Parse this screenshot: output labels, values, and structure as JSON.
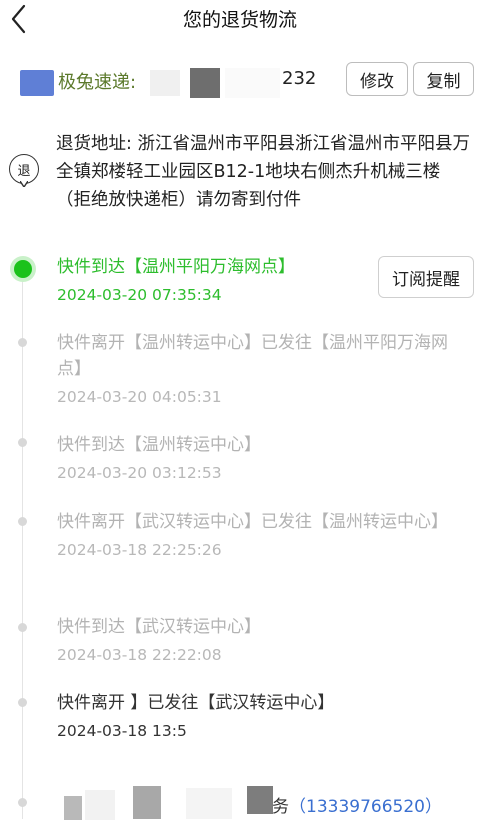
{
  "header": {
    "title": "您的退货物流"
  },
  "courier": {
    "name": "极兔速递:",
    "tracking_tail": "232",
    "edit_label": "修改",
    "copy_label": "复制",
    "logo_color": "#5f7fd6"
  },
  "address": {
    "icon_label": "退",
    "text": "退货地址: 浙江省温州市平阳县浙江省温州市平阳县万全镇郑楼轻工业园区B12-1地块右侧杰升机械三楼（拒绝放快递柜）请勿寄到付件"
  },
  "timeline": {
    "subscribe_label": "订阅提醒",
    "active_color": "#2dbd2d",
    "events": [
      {
        "title": "快件到达【温州平阳万海网点】",
        "time": "2024-03-20 07:35:34"
      },
      {
        "title": "快件离开【温州转运中心】已发往【温州平阳万海网点】",
        "time": "2024-03-20 04:05:31"
      },
      {
        "title": "快件到达【温州转运中心】",
        "time": "2024-03-20 03:12:53"
      },
      {
        "title": "快件离开【武汉转运中心】已发往【温州转运中心】",
        "time": "2024-03-18 22:25:26"
      },
      {
        "title": "快件到达【武汉转运中心】",
        "time": "2024-03-18 22:22:08"
      },
      {
        "title": "快件离开 】已发往【武汉转运中心】",
        "time": "2024-03-18 13:5"
      }
    ]
  },
  "bottom": {
    "service_prefix": "务",
    "service_phone": "（13339766520）",
    "phone_color": "#3a6fd0"
  }
}
